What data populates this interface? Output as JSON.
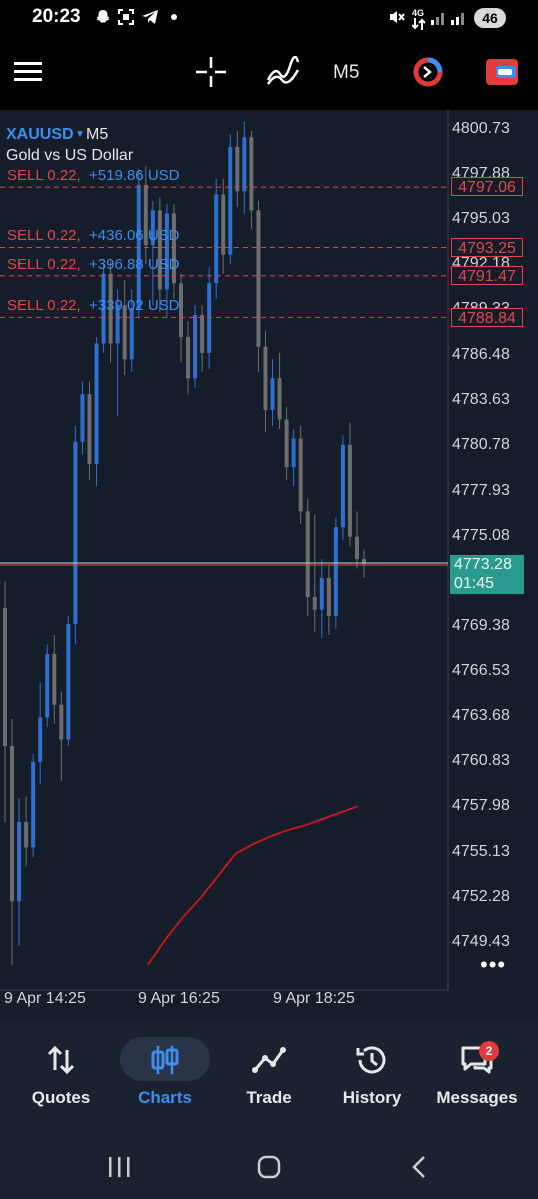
{
  "status_bar": {
    "time": "20:23",
    "network": "4G",
    "battery": "46",
    "icons": [
      "snapchat-icon",
      "scan-icon",
      "telegram-icon",
      "dot-icon",
      "mute-icon",
      "data-icon",
      "signal-icon",
      "signal-icon"
    ]
  },
  "toolbar": {
    "icons": [
      "menu-icon",
      "crosshair-icon",
      "indicators-icon",
      "timeframe",
      "trade-signal-icon",
      "one-click-trading-icon"
    ],
    "timeframe": "M5"
  },
  "chart": {
    "symbol": "XAUUSD",
    "timeframe": "M5",
    "description": "Gold vs US Dollar",
    "orders": [
      {
        "type": "SELL 0.22,",
        "profit": "+519.86 USD",
        "price": "4797.06"
      },
      {
        "type": "SELL 0.22,",
        "profit": "+436.06 USD",
        "price": "4793.25"
      },
      {
        "type": "SELL 0.22,",
        "profit": "+396.88 USD",
        "price": "4791.47"
      },
      {
        "type": "SELL 0.22,",
        "profit": "+339.02 USD",
        "price": "4788.84"
      }
    ],
    "price_ticks": [
      "4800.73",
      "4797.88",
      "4795.03",
      "4792.18",
      "4789.33",
      "4786.48",
      "4783.63",
      "4780.78",
      "4777.93",
      "4775.08",
      "4769.38",
      "4766.53",
      "4763.68",
      "4760.83",
      "4757.98",
      "4755.13",
      "4752.28",
      "4749.43"
    ],
    "current_price": "4773.28",
    "countdown": "01:45",
    "time_ticks": [
      "9 Apr 14:25",
      "9 Apr 16:25",
      "9 Apr 18:25"
    ],
    "more": "•••",
    "colors": {
      "bull": "#2f6fd0",
      "bear": "#6e6e6e",
      "order_line": "#e04848",
      "ma": "#d01818",
      "background": "#151d2a",
      "current_price": "#2a9a8e"
    }
  },
  "chart_data": {
    "type": "candlestick",
    "title": "XAUUSD, M5",
    "y_unit": "USD",
    "ylim": [
      4747.5,
      4802.5
    ],
    "x_start_time": "9 Apr 14:25",
    "candles": [
      {
        "o": 4770.5,
        "h": 4772.2,
        "l": 4757.0,
        "c": 4761.8
      },
      {
        "o": 4761.8,
        "h": 4763.5,
        "l": 4748.0,
        "c": 4752.0
      },
      {
        "o": 4752.0,
        "h": 4758.5,
        "l": 4749.2,
        "c": 4757.0
      },
      {
        "o": 4757.0,
        "h": 4758.6,
        "l": 4754.2,
        "c": 4755.4
      },
      {
        "o": 4755.4,
        "h": 4761.3,
        "l": 4754.8,
        "c": 4760.8
      },
      {
        "o": 4760.8,
        "h": 4765.8,
        "l": 4759.4,
        "c": 4763.6
      },
      {
        "o": 4763.6,
        "h": 4768.2,
        "l": 4763.0,
        "c": 4767.6
      },
      {
        "o": 4767.6,
        "h": 4768.8,
        "l": 4763.2,
        "c": 4764.4
      },
      {
        "o": 4764.4,
        "h": 4765.2,
        "l": 4759.6,
        "c": 4762.2
      },
      {
        "o": 4762.2,
        "h": 4770.0,
        "l": 4761.8,
        "c": 4769.5
      },
      {
        "o": 4769.5,
        "h": 4782.0,
        "l": 4768.2,
        "c": 4781.0
      },
      {
        "o": 4781.0,
        "h": 4784.8,
        "l": 4780.2,
        "c": 4784.0
      },
      {
        "o": 4784.0,
        "h": 4784.8,
        "l": 4778.6,
        "c": 4779.6
      },
      {
        "o": 4779.6,
        "h": 4787.6,
        "l": 4778.2,
        "c": 4787.2
      },
      {
        "o": 4787.2,
        "h": 4792.2,
        "l": 4786.6,
        "c": 4791.6
      },
      {
        "o": 4791.6,
        "h": 4792.4,
        "l": 4786.0,
        "c": 4787.2
      },
      {
        "o": 4787.2,
        "h": 4790.6,
        "l": 4782.6,
        "c": 4789.6
      },
      {
        "o": 4789.6,
        "h": 4791.2,
        "l": 4785.2,
        "c": 4786.2
      },
      {
        "o": 4786.2,
        "h": 4790.6,
        "l": 4785.4,
        "c": 4789.4
      },
      {
        "o": 4789.4,
        "h": 4798.2,
        "l": 4788.8,
        "c": 4797.2
      },
      {
        "o": 4797.2,
        "h": 4798.4,
        "l": 4792.2,
        "c": 4793.4
      },
      {
        "o": 4793.4,
        "h": 4796.2,
        "l": 4789.6,
        "c": 4795.6
      },
      {
        "o": 4795.6,
        "h": 4796.4,
        "l": 4789.2,
        "c": 4790.6
      },
      {
        "o": 4790.6,
        "h": 4796.0,
        "l": 4788.8,
        "c": 4795.4
      },
      {
        "o": 4795.4,
        "h": 4796.0,
        "l": 4790.0,
        "c": 4791.0
      },
      {
        "o": 4791.0,
        "h": 4791.6,
        "l": 4786.0,
        "c": 4787.6
      },
      {
        "o": 4787.6,
        "h": 4788.6,
        "l": 4784.0,
        "c": 4785.0
      },
      {
        "o": 4785.0,
        "h": 4789.6,
        "l": 4784.4,
        "c": 4789.0
      },
      {
        "o": 4789.0,
        "h": 4789.6,
        "l": 4785.4,
        "c": 4786.6
      },
      {
        "o": 4786.6,
        "h": 4792.0,
        "l": 4785.6,
        "c": 4791.0
      },
      {
        "o": 4791.0,
        "h": 4797.6,
        "l": 4790.0,
        "c": 4796.6
      },
      {
        "o": 4796.6,
        "h": 4797.6,
        "l": 4791.6,
        "c": 4792.8
      },
      {
        "o": 4792.8,
        "h": 4800.4,
        "l": 4792.2,
        "c": 4799.6
      },
      {
        "o": 4799.6,
        "h": 4800.6,
        "l": 4795.8,
        "c": 4796.8
      },
      {
        "o": 4796.8,
        "h": 4801.2,
        "l": 4795.4,
        "c": 4800.2
      },
      {
        "o": 4800.2,
        "h": 4800.6,
        "l": 4794.4,
        "c": 4795.6
      },
      {
        "o": 4795.6,
        "h": 4796.2,
        "l": 4785.4,
        "c": 4787.0
      },
      {
        "o": 4787.0,
        "h": 4788.0,
        "l": 4781.6,
        "c": 4783.0
      },
      {
        "o": 4783.0,
        "h": 4786.2,
        "l": 4782.0,
        "c": 4785.0
      },
      {
        "o": 4785.0,
        "h": 4786.6,
        "l": 4781.8,
        "c": 4782.4
      },
      {
        "o": 4782.4,
        "h": 4783.2,
        "l": 4778.6,
        "c": 4779.4
      },
      {
        "o": 4779.4,
        "h": 4781.8,
        "l": 4778.2,
        "c": 4781.2
      },
      {
        "o": 4781.2,
        "h": 4782.0,
        "l": 4775.8,
        "c": 4776.6
      },
      {
        "o": 4776.6,
        "h": 4777.4,
        "l": 4770.0,
        "c": 4771.2
      },
      {
        "o": 4771.2,
        "h": 4776.4,
        "l": 4769.0,
        "c": 4770.4
      },
      {
        "o": 4770.4,
        "h": 4773.6,
        "l": 4768.6,
        "c": 4772.4
      },
      {
        "o": 4772.4,
        "h": 4773.2,
        "l": 4768.8,
        "c": 4770.0
      },
      {
        "o": 4770.0,
        "h": 4776.2,
        "l": 4769.2,
        "c": 4775.6
      },
      {
        "o": 4775.6,
        "h": 4781.4,
        "l": 4774.8,
        "c": 4780.8
      },
      {
        "o": 4780.8,
        "h": 4782.2,
        "l": 4774.4,
        "c": 4775.0
      },
      {
        "o": 4775.0,
        "h": 4776.6,
        "l": 4773.0,
        "c": 4773.6
      },
      {
        "o": 4773.6,
        "h": 4774.2,
        "l": 4772.4,
        "c": 4773.28
      }
    ],
    "ma_series": [
      4748.0,
      4749.6,
      4751.0,
      4752.2,
      4753.6,
      4755.0,
      4755.6,
      4756.1,
      4756.5,
      4756.8,
      4757.2,
      4757.6,
      4758.0
    ]
  },
  "bottom_nav": {
    "items": [
      {
        "label": "Quotes",
        "icon": "quotes-icon",
        "active": false
      },
      {
        "label": "Charts",
        "icon": "charts-icon",
        "active": true
      },
      {
        "label": "Trade",
        "icon": "trade-icon",
        "active": false
      },
      {
        "label": "History",
        "icon": "history-icon",
        "active": false
      },
      {
        "label": "Messages",
        "icon": "messages-icon",
        "active": false,
        "badge": "2"
      }
    ]
  },
  "system_nav": {
    "icons": [
      "recent-apps-icon",
      "home-icon",
      "back-icon"
    ]
  }
}
